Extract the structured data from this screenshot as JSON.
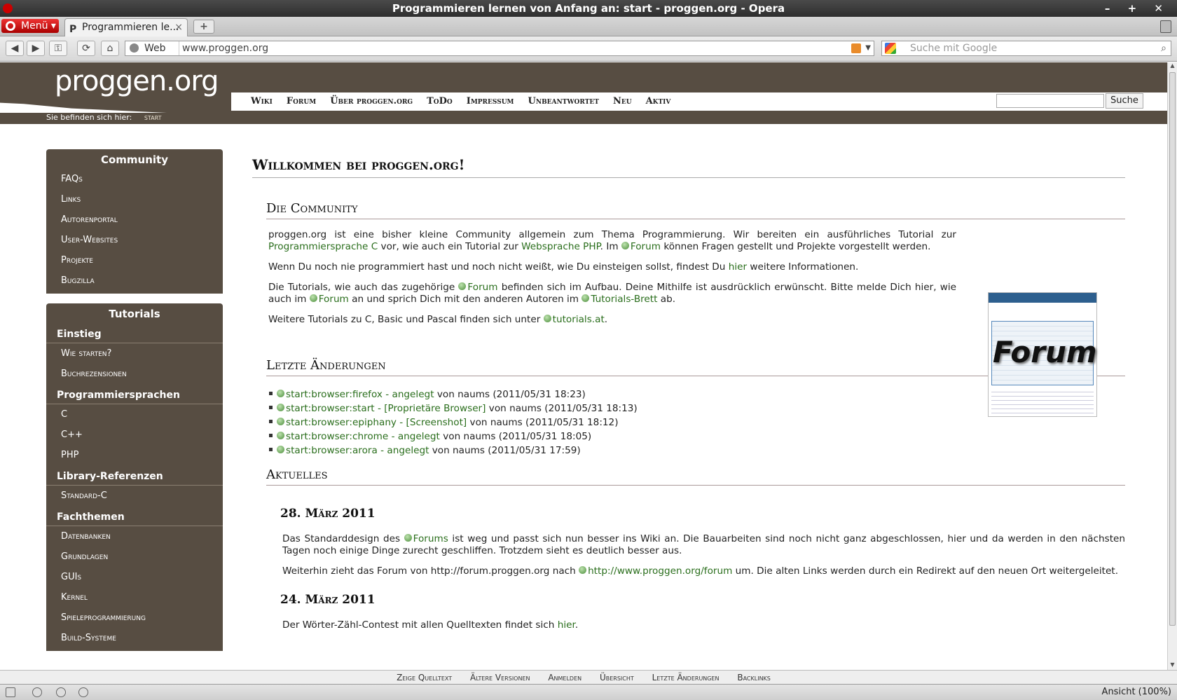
{
  "window": {
    "title": "Programmieren lernen von Anfang an: start - proggen.org - Opera",
    "controls": "– + ✕"
  },
  "tabbar": {
    "menu_label": "Menü",
    "tab_title": "Programmieren le...",
    "tab_close": "×",
    "new_tab": "+"
  },
  "navbar": {
    "back": "◀",
    "forward": "▶",
    "key": "⚿",
    "reload": "⟳",
    "home": "⌂",
    "web_label": "Web",
    "url": "www.proggen.org",
    "search_placeholder": "Suche mit Google"
  },
  "site": {
    "logo": "proggen.org",
    "nav": [
      "Wiki",
      "Forum",
      "Über proggen.org",
      "ToDo",
      "Impressum",
      "Unbeantwortet",
      "Neu",
      "Aktiv"
    ],
    "search_button": "Suche",
    "breadcrumb_label": "Sie befinden sich hier:",
    "breadcrumb_current": "start"
  },
  "sidebar": {
    "community": {
      "title": "Community",
      "items": [
        "FAQs",
        "Links",
        "Autorenportal",
        "User-Websites",
        "Projekte",
        "Bugzilla"
      ]
    },
    "tutorials": {
      "title": "Tutorials",
      "groups": [
        {
          "label": "Einstieg",
          "items": [
            "Wie starten?",
            "Buchrezensionen"
          ]
        },
        {
          "label": "Programmiersprachen",
          "items": [
            "C",
            "C++",
            "PHP"
          ]
        },
        {
          "label": "Library-Referenzen",
          "items": [
            "Standard-C"
          ]
        },
        {
          "label": "Fachthemen",
          "items": [
            "Datenbanken",
            "Grundlagen",
            "GUIs",
            "Kernel",
            "Spieleprogrammierung",
            "Build-Systeme"
          ]
        }
      ]
    }
  },
  "content": {
    "welcome": "Willkommen bei proggen.org!",
    "community_heading": "Die Community",
    "p1_a": "proggen.org ist eine bisher kleine Community allgemein zum Thema Programmierung. Wir bereiten ein ausführliches Tutorial zur ",
    "p1_link1": "Programmiersprache C",
    "p1_b": " vor, wie auch ein Tutorial zur ",
    "p1_link2": "Websprache PHP",
    "p1_c": ". Im ",
    "p1_link3": "Forum",
    "p1_d": " können Fragen gestellt und Projekte vorgestellt werden.",
    "p2_a": "Wenn Du noch nie programmiert hast und noch nicht weißt, wie Du einsteigen sollst, findest Du ",
    "p2_link": "hier",
    "p2_b": " weitere Informationen.",
    "p3_a": "Die Tutorials, wie auch das zugehörige ",
    "p3_link1": "Forum",
    "p3_b": " befinden sich im Aufbau. Deine Mithilfe ist ausdrücklich erwünscht. Bitte melde Dich hier, wie auch im ",
    "p3_link2": "Forum",
    "p3_c": " an und sprich Dich mit den anderen Autoren im ",
    "p3_link3": "Tutorials-Brett",
    "p3_d": " ab.",
    "p4_a": "Weitere Tutorials zu C, Basic und Pascal finden sich unter ",
    "p4_link": "tutorials.at",
    "p4_b": ".",
    "forum_image_text": "Forum",
    "changes_heading": "Letzte Änderungen",
    "changes": [
      {
        "page": "start:browser:firefox",
        "sep": " - ",
        "summary": "angelegt",
        "by": " von naums (2011/05/31 18:23)"
      },
      {
        "page": "start:browser:start",
        "sep": " - ",
        "summary": "[Proprietäre Browser]",
        "by": " von naums (2011/05/31 18:13)"
      },
      {
        "page": "start:browser:epiphany",
        "sep": " - ",
        "summary": "[Screenshot]",
        "by": " von naums (2011/05/31 18:12)"
      },
      {
        "page": "start:browser:chrome",
        "sep": " - ",
        "summary": "angelegt",
        "by": " von naums (2011/05/31 18:05)"
      },
      {
        "page": "start:browser:arora",
        "sep": " - ",
        "summary": "angelegt",
        "by": " von naums (2011/05/31 17:59)"
      }
    ],
    "news_heading": "Aktuelles",
    "news": [
      {
        "date": "28. März 2011",
        "p1_a": "Das Standarddesign des ",
        "p1_link": "Forums",
        "p1_b": " ist weg und passt sich nun besser ins Wiki an. Die Bauarbeiten sind noch nicht ganz abgeschlossen, hier und da werden in den nächsten Tagen noch einige Dinge zurecht geschliffen. Trotzdem sieht es deutlich besser aus.",
        "p2_a": "Weiterhin zieht das Forum von http://forum.proggen.org nach ",
        "p2_link": "http://www.proggen.org/forum",
        "p2_b": " um. Die alten Links werden durch ein Redirekt auf den neuen Ort weitergeleitet."
      },
      {
        "date": "24. März 2011",
        "p1_a": "Der Wörter-Zähl-Contest mit allen Quelltexten findet sich ",
        "p1_link": "hier",
        "p1_b": "."
      }
    ]
  },
  "footer": {
    "links": [
      "Zeige Quelltext",
      "Ältere Versionen",
      "Anmelden",
      "Übersicht",
      "Letzte Änderungen",
      "Backlinks"
    ]
  },
  "statusbar": {
    "zoom": "Ansicht (100%)"
  }
}
